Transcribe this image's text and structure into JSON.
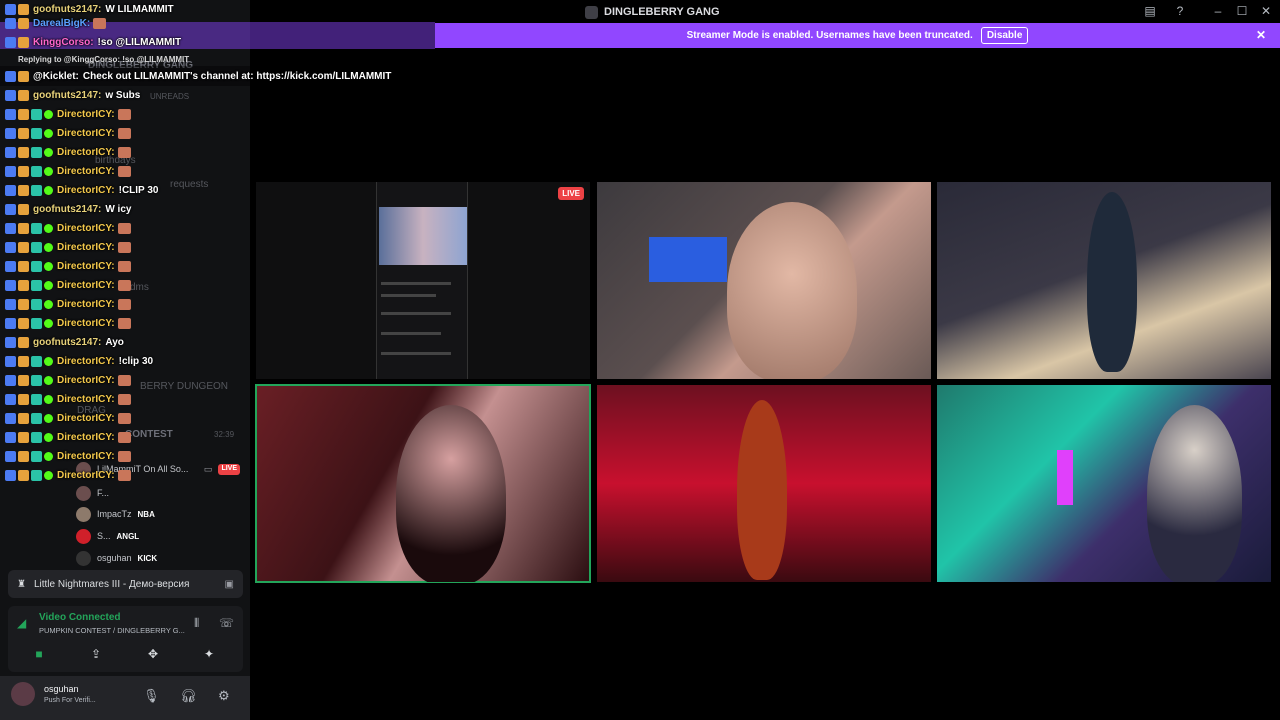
{
  "titlebar": {
    "server_name": "DINGLEBERRY GANG",
    "icons": [
      "inbox-icon",
      "help-icon",
      "minimize-icon",
      "maximize-icon",
      "close-icon"
    ]
  },
  "banner": {
    "text": "Streamer Mode is enabled. Usernames have been truncated.",
    "disable_label": "Disable"
  },
  "chat": {
    "reply_context": "Replying to @KinggCorso: !so @LILMAMMIT",
    "lines": [
      {
        "user": "goofnuts2147:",
        "color": "#e8d27a",
        "text": "W LILMAMMIT"
      },
      {
        "user": "DarealBigK:",
        "color": "#5aa0ff",
        "text": ""
      },
      {
        "user": "KinggCorso:",
        "color": "#ff66cc",
        "text": "!so @LILMAMMIT"
      },
      {
        "user": "@Kicklet:",
        "color": "#ffffff",
        "text": "Check out LILMAMMIT's channel at: https://kick.com/LILMAMMIT"
      },
      {
        "user": "goofnuts2147:",
        "color": "#e8d27a",
        "text": "w Subs"
      },
      {
        "user": "DirectorICY:",
        "color": "#f3c84b",
        "text": ""
      },
      {
        "user": "DirectorICY:",
        "color": "#f3c84b",
        "text": ""
      },
      {
        "user": "DirectorICY:",
        "color": "#f3c84b",
        "text": ""
      },
      {
        "user": "DirectorICY:",
        "color": "#f3c84b",
        "text": ""
      },
      {
        "user": "DirectorICY:",
        "color": "#f3c84b",
        "text": "!CLIP 30"
      },
      {
        "user": "goofnuts2147:",
        "color": "#e8d27a",
        "text": "W icy"
      },
      {
        "user": "DirectorICY:",
        "color": "#f3c84b",
        "text": ""
      },
      {
        "user": "DirectorICY:",
        "color": "#f3c84b",
        "text": ""
      },
      {
        "user": "DirectorICY:",
        "color": "#f3c84b",
        "text": ""
      },
      {
        "user": "DirectorICY:",
        "color": "#f3c84b",
        "text": ""
      },
      {
        "user": "DirectorICY:",
        "color": "#f3c84b",
        "text": ""
      },
      {
        "user": "DirectorICY:",
        "color": "#f3c84b",
        "text": ""
      },
      {
        "user": "goofnuts2147:",
        "color": "#e8d27a",
        "text": "Ayo"
      },
      {
        "user": "DirectorICY:",
        "color": "#f3c84b",
        "text": "!clip 30"
      },
      {
        "user": "DirectorICY:",
        "color": "#f3c84b",
        "text": ""
      },
      {
        "user": "DirectorICY:",
        "color": "#f3c84b",
        "text": ""
      },
      {
        "user": "DirectorICY:",
        "color": "#f3c84b",
        "text": ""
      },
      {
        "user": "DirectorICY:",
        "color": "#f3c84b",
        "text": ""
      },
      {
        "user": "DirectorICY:",
        "color": "#f3c84b",
        "text": ""
      },
      {
        "user": "DirectorICY:",
        "color": "#f3c84b",
        "text": ""
      }
    ]
  },
  "sidebar": {
    "ghost_server": "DINGLEBERRY GANG",
    "ghost_unreads": "UNREADS",
    "ghost_channel_1": "birthdays",
    "ghost_channel_2": "requests",
    "ghost_channel_3": "dms",
    "ghost_voice_1": "BERRY DUNGEON",
    "ghost_voice_2": "DRAG",
    "ghost_voice_3": "CONTEST",
    "ghost_timer": "32:39",
    "members": [
      {
        "name": "LilMammiT On All So...",
        "tag": "",
        "live": "LIVE"
      },
      {
        "name": "F...",
        "tag": "",
        "live": ""
      },
      {
        "name": "ImpacTz",
        "tag": "NBA",
        "live": ""
      },
      {
        "name": "S...",
        "tag": "ANGL",
        "live": ""
      },
      {
        "name": "osguhan",
        "tag": "KICK",
        "live": ""
      }
    ]
  },
  "activity": {
    "game": "Little Nightmares III - Демо-версия"
  },
  "voice": {
    "status": "Video Connected",
    "channel": "PUMPKIN CONTEST / DINGLEBERRY G..."
  },
  "user": {
    "name": "osguhan",
    "status": "Push For Verifi..."
  },
  "grid": {
    "live_label": "LIVE"
  },
  "colors": {
    "accent_purple": "#9147ff",
    "voice_green": "#23a55a",
    "live_red": "#ed4245"
  }
}
